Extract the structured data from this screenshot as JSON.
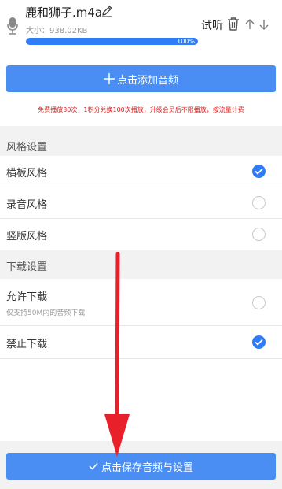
{
  "file": {
    "name": "鹿和狮子.m4a",
    "size_label": "大小：938.02KB",
    "progress_text": "100%",
    "progress_percent": 100,
    "preview_label": "试听",
    "icons": {
      "mic": "microphone-icon",
      "edit": "pencil-icon",
      "delete": "trash-icon",
      "move_up": "arrow-up-icon",
      "move_down": "arrow-down-icon"
    }
  },
  "add_audio": {
    "label": "点击添加音频",
    "icon": "plus-icon"
  },
  "notice": "免费播放30次，1积分兑换100次播放，升级会员后不限播放，按流量计费",
  "style_section": {
    "title": "风格设置",
    "options": [
      {
        "label": "横板风格",
        "selected": true
      },
      {
        "label": "录音风格",
        "selected": false
      },
      {
        "label": "竖版风格",
        "selected": false
      }
    ]
  },
  "download_section": {
    "title": "下载设置",
    "options": [
      {
        "label": "允许下载",
        "sub": "仅支持50M内的音频下载",
        "selected": false
      },
      {
        "label": "禁止下载",
        "selected": true
      }
    ]
  },
  "save_button": {
    "label": "点击保存音频与设置",
    "icon": "check-icon"
  },
  "colors": {
    "primary": "#4a8ef3",
    "progress": "#2f7df6",
    "notice": "#e02020",
    "annotation_arrow": "#e8202a",
    "section_background": "#f2f2f2"
  }
}
